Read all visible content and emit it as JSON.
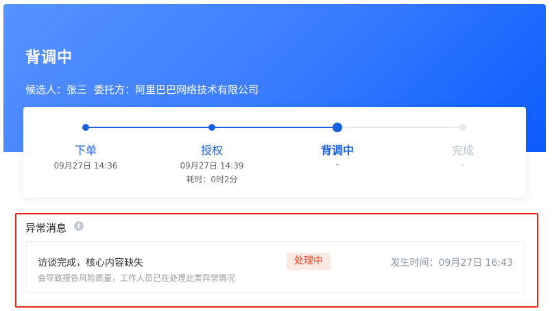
{
  "header": {
    "status": "背调中",
    "candidate": "候选人：张三",
    "client": "委托方：阿里巴巴网络技术有限公司"
  },
  "steps": [
    {
      "label": "下单",
      "time": "09月27日 14:36",
      "state": "done"
    },
    {
      "label": "授权",
      "time": "09月27日 14:39",
      "duration": "耗时：0时2分",
      "state": "done"
    },
    {
      "label": "背调中",
      "time": "-",
      "state": "current"
    },
    {
      "label": "完成",
      "time": "-",
      "state": "todo"
    }
  ],
  "alerts": {
    "title": "异常消息",
    "info_icon": "i",
    "items": [
      {
        "message": "访谈完成，核心内容缺失",
        "detail": "会导致报告风险质量，工作人员已在处理此类异常情况",
        "status": "处理中",
        "time": "发生时间：09月27日 16:43"
      }
    ]
  },
  "colors": {
    "primary": "#1a5fe0",
    "banner_start": "#5792ff",
    "banner_end": "#0a5cfb",
    "alert_border": "#e8271b",
    "badge_bg": "#fde8e4",
    "badge_text": "#e8451b"
  }
}
